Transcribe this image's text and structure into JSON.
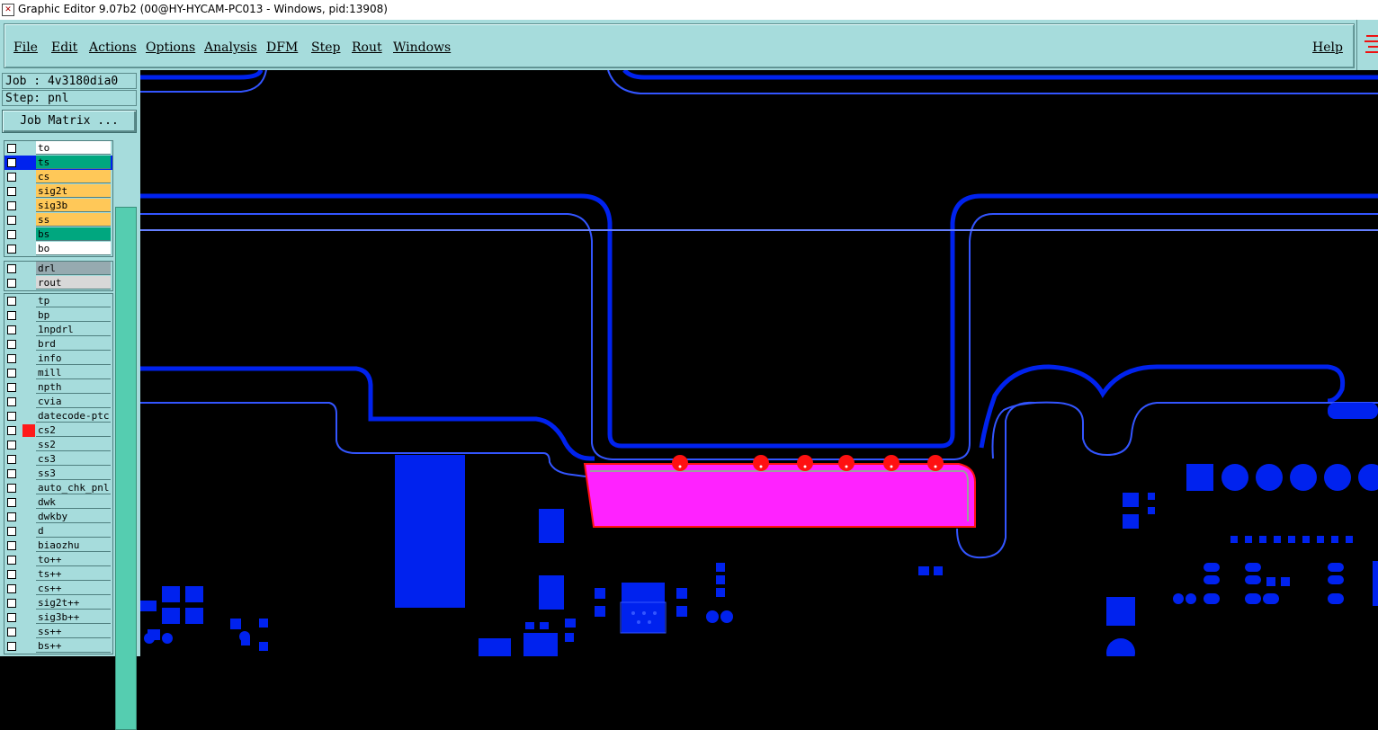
{
  "window": {
    "title": "Graphic Editor 9.07b2 (00@HY-HYCAM-PC013 - Windows, pid:13908)"
  },
  "menu": [
    "File",
    "Edit",
    "Actions",
    "Options",
    "Analysis",
    "DFM",
    "Step",
    "Rout",
    "Windows"
  ],
  "help_label": "Help",
  "job": {
    "label": "Job : 4v3180dia0",
    "step": "Step: pnl",
    "matrix_button": "Job Matrix ..."
  },
  "layer_groups": [
    [
      {
        "name": "to",
        "bg": "#ffffff",
        "swatch": ""
      },
      {
        "name": "ts",
        "bg": "#00a77f",
        "swatch": "#0022ee",
        "selected": true
      },
      {
        "name": "cs",
        "bg": "#ffc858",
        "swatch": ""
      },
      {
        "name": "sig2t",
        "bg": "#ffc858",
        "swatch": ""
      },
      {
        "name": "sig3b",
        "bg": "#ffc858",
        "swatch": ""
      },
      {
        "name": "ss",
        "bg": "#ffc858",
        "swatch": ""
      },
      {
        "name": "bs",
        "bg": "#00a77f",
        "swatch": ""
      },
      {
        "name": "bo",
        "bg": "#ffffff",
        "swatch": ""
      }
    ],
    [
      {
        "name": "drl",
        "bg": "#96aab0",
        "swatch": ""
      },
      {
        "name": "rout",
        "bg": "#d8d8d8",
        "swatch": ""
      }
    ],
    [
      {
        "name": "tp",
        "bg": "#a6dcdc",
        "swatch": ""
      },
      {
        "name": "bp",
        "bg": "#a6dcdc",
        "swatch": ""
      },
      {
        "name": "1npdrl",
        "bg": "#a6dcdc",
        "swatch": ""
      },
      {
        "name": "brd",
        "bg": "#a6dcdc",
        "swatch": ""
      },
      {
        "name": "info",
        "bg": "#a6dcdc",
        "swatch": ""
      },
      {
        "name": "mill",
        "bg": "#a6dcdc",
        "swatch": ""
      },
      {
        "name": "npth",
        "bg": "#a6dcdc",
        "swatch": ""
      },
      {
        "name": "cvia",
        "bg": "#a6dcdc",
        "swatch": ""
      },
      {
        "name": "datecode-ptc",
        "bg": "#a6dcdc",
        "swatch": ""
      },
      {
        "name": "cs2",
        "bg": "#a6dcdc",
        "swatch": "#ff1a1a"
      },
      {
        "name": "ss2",
        "bg": "#a6dcdc",
        "swatch": ""
      },
      {
        "name": "cs3",
        "bg": "#a6dcdc",
        "swatch": ""
      },
      {
        "name": "ss3",
        "bg": "#a6dcdc",
        "swatch": ""
      },
      {
        "name": "auto_chk_pnl",
        "bg": "#a6dcdc",
        "swatch": ""
      },
      {
        "name": "dwk",
        "bg": "#a6dcdc",
        "swatch": ""
      },
      {
        "name": "dwkby",
        "bg": "#a6dcdc",
        "swatch": ""
      },
      {
        "name": "d",
        "bg": "#a6dcdc",
        "swatch": ""
      },
      {
        "name": "biaozhu",
        "bg": "#a6dcdc",
        "swatch": ""
      },
      {
        "name": "to++",
        "bg": "#a6dcdc",
        "swatch": ""
      },
      {
        "name": "ts++",
        "bg": "#a6dcdc",
        "swatch": ""
      },
      {
        "name": "cs++",
        "bg": "#a6dcdc",
        "swatch": ""
      },
      {
        "name": "sig2t++",
        "bg": "#a6dcdc",
        "swatch": ""
      },
      {
        "name": "sig3b++",
        "bg": "#a6dcdc",
        "swatch": ""
      },
      {
        "name": "ss++",
        "bg": "#a6dcdc",
        "swatch": ""
      },
      {
        "name": "bs++",
        "bg": "#a6dcdc",
        "swatch": ""
      }
    ]
  ],
  "colors": {
    "trace": "#0022ee",
    "outline": "#3355ff",
    "highlight": "#ff22ff",
    "highlight_border": "#ff1111",
    "panel": "#a6dcdc"
  }
}
